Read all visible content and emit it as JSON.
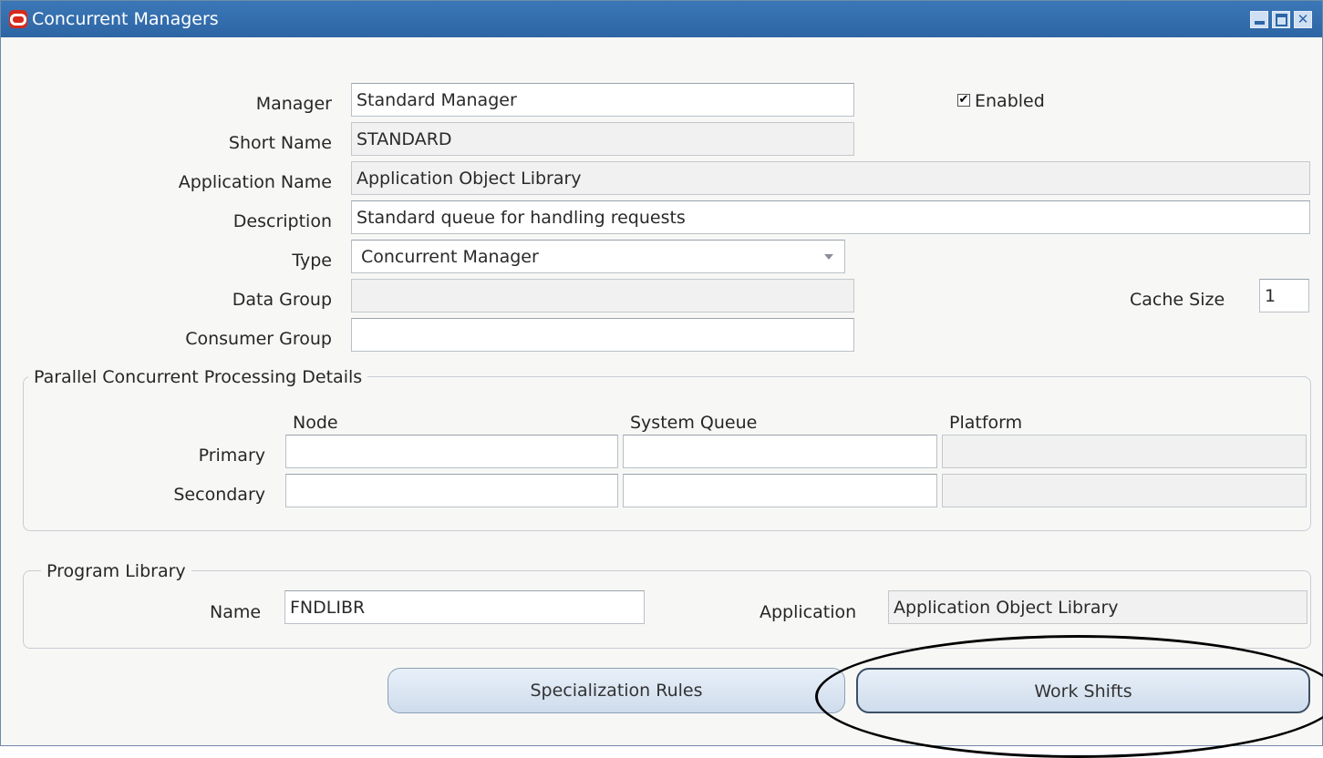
{
  "window": {
    "title": "Concurrent Managers"
  },
  "form": {
    "manager_label": "Manager",
    "manager_value": "Standard Manager",
    "enabled_label": "Enabled",
    "enabled_checked": "✔",
    "short_name_label": "Short Name",
    "short_name_value": "STANDARD",
    "application_name_label": "Application Name",
    "application_name_value": "Application Object Library",
    "description_label": "Description",
    "description_value": "Standard queue for handling requests",
    "type_label": "Type",
    "type_value": "Concurrent Manager",
    "data_group_label": "Data Group",
    "data_group_value": "",
    "cache_size_label": "Cache Size",
    "cache_size_value": "1",
    "consumer_group_label": "Consumer Group",
    "consumer_group_value": ""
  },
  "parallel": {
    "title": "Parallel Concurrent Processing Details",
    "col_node": "Node",
    "col_system_queue": "System Queue",
    "col_platform": "Platform",
    "row_primary": "Primary",
    "row_secondary": "Secondary",
    "primary": {
      "node": "",
      "system_queue": "",
      "platform": ""
    },
    "secondary": {
      "node": "",
      "system_queue": "",
      "platform": ""
    }
  },
  "library": {
    "title": "Program Library",
    "name_label": "Name",
    "name_value": "FNDLIBR",
    "application_label": "Application",
    "application_value": "Application Object Library"
  },
  "buttons": {
    "specialization_rules": "Specialization Rules",
    "work_shifts": "Work Shifts"
  },
  "colors": {
    "titlebar": "#2d65a4",
    "oracle_logo": "#d8291b",
    "highlight_ellipse": "#000000"
  }
}
